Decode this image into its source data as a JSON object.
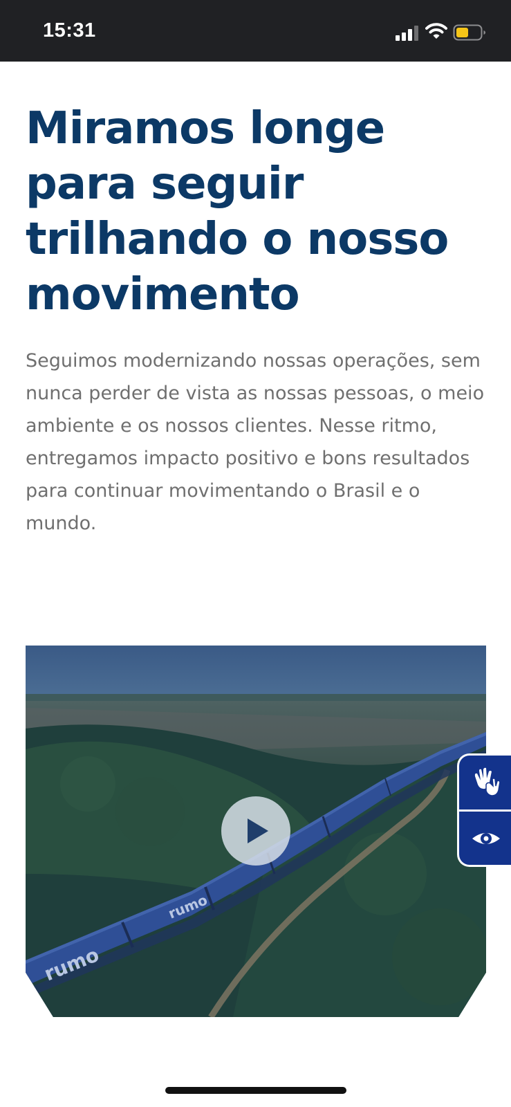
{
  "status_bar": {
    "time": "15:31",
    "icons": [
      "signal-icon",
      "wifi-icon",
      "battery-icon"
    ],
    "battery_level": 0.5,
    "battery_color": "#f5c518"
  },
  "headline": "Miramos longe para seguir trilhando o nosso movimento",
  "intro": "Seguimos modernizando nossas operações, sem nunca perder de vista as nossas pessoas, o meio ambiente e os nossos clientes. Nesse ritmo, entregamos impacto positivo e bons resultados para continuar movimentando o Brasil e o mundo.",
  "video": {
    "brand_mark": "rumo",
    "play_icon": "play-icon"
  },
  "accessibility": {
    "sign_language_icon": "sign-language-hands-icon",
    "visual_icon": "eye-icon"
  },
  "colors": {
    "headline": "#0c3966",
    "body_text": "#6f6f6f",
    "accessibility_panel": "#13338c",
    "status_bar": "#202124"
  }
}
